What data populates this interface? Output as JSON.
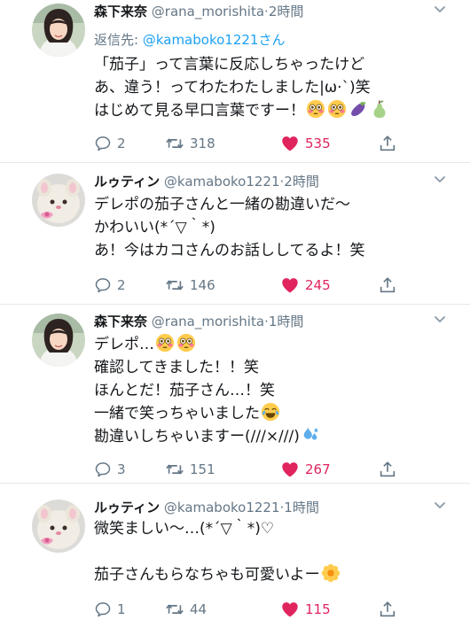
{
  "tweets": [
    {
      "name": "森下来奈",
      "handle": "@rana_morishita",
      "time": "2時間",
      "reply_prefix": "返信先: ",
      "reply_to": "@kamaboko1221さん",
      "lines": [
        "「茄子」って言葉に反応しちゃったけど",
        "あ、違う！ってわたわたしました|ω·`)笑",
        "はじめて見る早口言葉ですー！"
      ],
      "emoji_line3": [
        "flushed-emoji",
        "flushed-emoji",
        "eggplant-emoji",
        "pear-emoji"
      ],
      "replies": "2",
      "retweets": "318",
      "likes": "535",
      "avatar": "photo"
    },
    {
      "name": "ルゥティン",
      "handle": "@kamaboko1221",
      "time": "2時間",
      "lines": [
        "デレポの茄子さんと一緒の勘違いだ〜",
        "かわいい(*´▽｀*)",
        "あ！今はカコさんのお話ししてるよ！笑"
      ],
      "replies": "2",
      "retweets": "146",
      "likes": "245",
      "avatar": "plush"
    },
    {
      "name": "森下来奈",
      "handle": "@rana_morishita",
      "time": "1時間",
      "lines": [
        "デレポ…",
        "確認してきました！！笑",
        "ほんとだ！茄子さん…！笑",
        "一緒で笑っちゃいました",
        "勘違いしちゃいますー(///×///)"
      ],
      "replies": "3",
      "retweets": "151",
      "likes": "267",
      "avatar": "photo"
    },
    {
      "name": "ルゥティン",
      "handle": "@kamaboko1221",
      "time": "1時間",
      "lines": [
        "微笑ましい〜…(*´▽｀*)♡",
        "",
        "茄子さんもらなちゃも可愛いよー"
      ],
      "replies": "1",
      "retweets": "44",
      "likes": "115",
      "avatar": "plush"
    }
  ],
  "colors": {
    "text": "#14171a",
    "secondary": "#657786",
    "link": "#1da1f2",
    "like": "#e0245e",
    "divider": "#e1e8ed"
  }
}
